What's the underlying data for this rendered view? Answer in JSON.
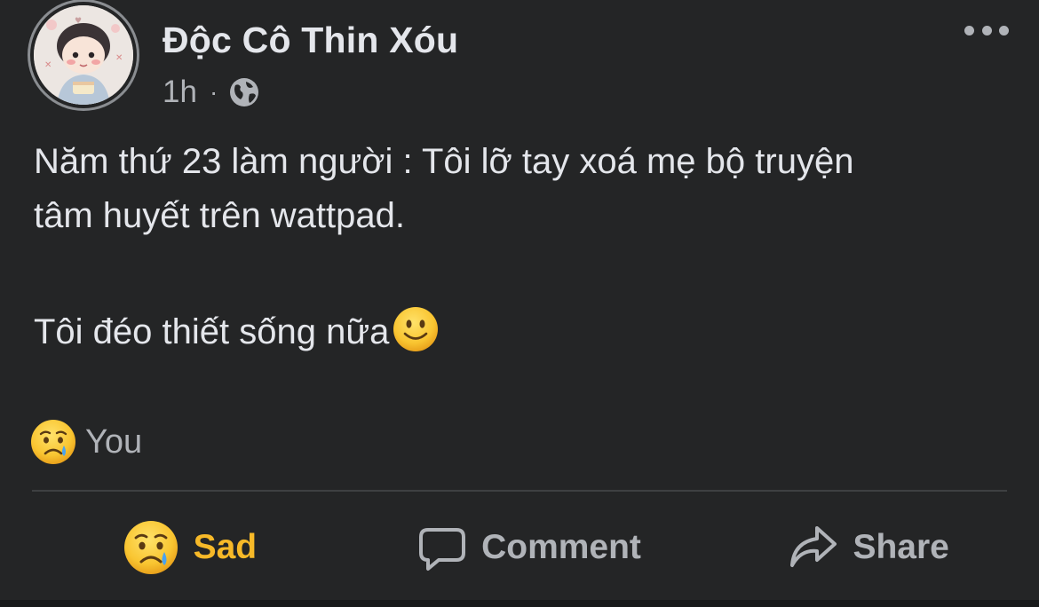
{
  "post": {
    "author": "Độc Cô Thin Xóu",
    "time": "1h",
    "separator": "·",
    "privacy_icon": "globe-icon",
    "more_icon": "more-dots-icon",
    "text_line1": "Năm thứ 23 làm người : Tôi lỡ tay xoá mẹ bộ truyện",
    "text_line2": "tâm huyết trên wattpad.",
    "text_line3": "Tôi đéo thiết sống nữa",
    "inline_emoji": "slightly-smiling-face"
  },
  "reactions": {
    "icon": "sad-reaction-icon",
    "summary": "You"
  },
  "actions": {
    "react_label": "Sad",
    "comment_label": "Comment",
    "share_label": "Share"
  },
  "colors": {
    "background": "#242526",
    "primary_text": "#e4e6eb",
    "secondary_text": "#b0b3b8",
    "sad_accent": "#f7b928",
    "divider": "#3e4042"
  }
}
